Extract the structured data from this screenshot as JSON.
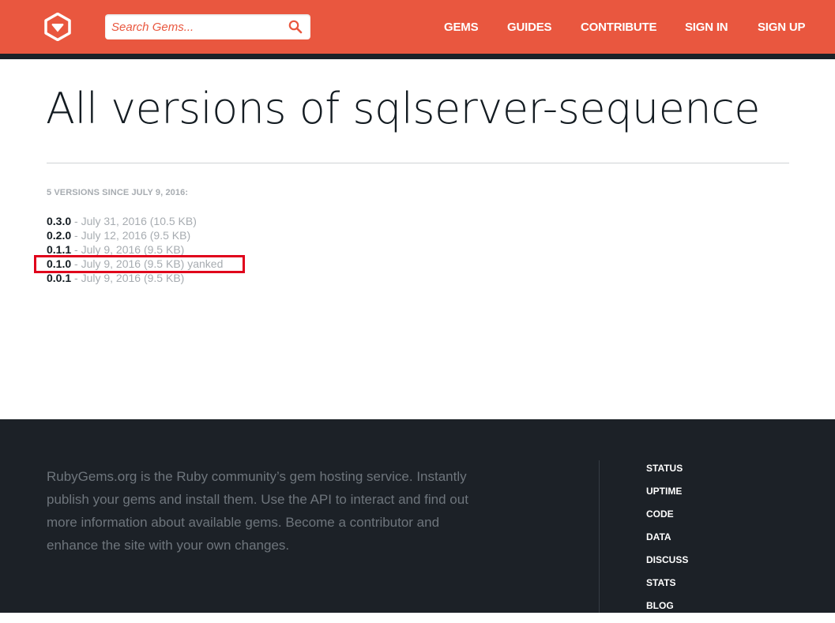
{
  "header": {
    "logo_icon": "rubygems-diamond-icon",
    "search": {
      "placeholder": "Search Gems...",
      "value": "",
      "icon": "search-icon"
    },
    "nav": {
      "gems": "GEMS",
      "guides": "GUIDES",
      "contribute": "CONTRIBUTE",
      "sign_in": "SIGN IN",
      "sign_up": "SIGN UP"
    }
  },
  "main": {
    "title": "All versions of sqlserver-sequence",
    "versions_heading": "5 VERSIONS SINCE JULY 9, 2016:",
    "versions": [
      {
        "number": "0.3.0",
        "details": "- July 31, 2016 (10.5 KB)"
      },
      {
        "number": "0.2.0",
        "details": "- July 12, 2016 (9.5 KB)"
      },
      {
        "number": "0.1.1",
        "details": "- July 9, 2016 (9.5 KB)"
      },
      {
        "number": "0.1.0",
        "details": "- July 9, 2016 (9.5 KB) yanked"
      },
      {
        "number": "0.0.1",
        "details": "- July 9, 2016 (9.5 KB)"
      }
    ]
  },
  "footer": {
    "description": "RubyGems.org is the Ruby community’s gem hosting service. Instantly publish your gems and install them. Use the API to interact and find out more information about available gems. Become a contributor and enhance the site with your own changes.",
    "links": [
      "STATUS",
      "UPTIME",
      "CODE",
      "DATA",
      "DISCUSS",
      "STATS",
      "BLOG"
    ]
  },
  "colors": {
    "brand": "#e9573f",
    "dark": "#1c2127",
    "highlight": "#e0001b"
  }
}
